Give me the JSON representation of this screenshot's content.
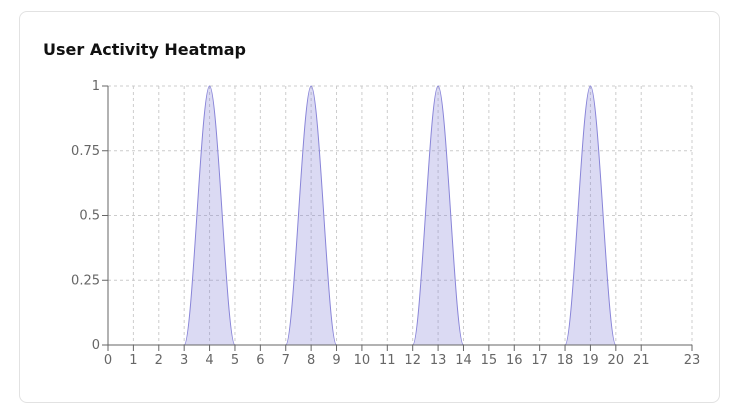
{
  "card": {
    "title": "User Activity Heatmap"
  },
  "chart_data": {
    "type": "area",
    "title": "User Activity Heatmap",
    "xlabel": "",
    "ylabel": "",
    "x": [
      0,
      1,
      2,
      3,
      4,
      5,
      6,
      7,
      8,
      9,
      10,
      11,
      12,
      13,
      14,
      15,
      16,
      17,
      18,
      19,
      20,
      21,
      23
    ],
    "series": [
      {
        "values": [
          0,
          0,
          0,
          0,
          1,
          0,
          0,
          0,
          1,
          0,
          0,
          0,
          0,
          1,
          0,
          0,
          0,
          0,
          0,
          1,
          0,
          0,
          0
        ]
      }
    ],
    "xticks": [
      0,
      1,
      2,
      3,
      4,
      5,
      6,
      7,
      8,
      9,
      10,
      11,
      12,
      13,
      14,
      15,
      16,
      17,
      18,
      19,
      20,
      21,
      23
    ],
    "yticks": [
      0,
      0.25,
      0.5,
      0.75,
      1
    ],
    "xlim": [
      0,
      23
    ],
    "ylim": [
      0,
      1
    ],
    "grid": true,
    "legend": "none",
    "curve": "monotone",
    "colors": {
      "stroke": "#8884d8",
      "fill": "#8884d8",
      "grid": "#cccccc",
      "axis": "#666666"
    }
  }
}
